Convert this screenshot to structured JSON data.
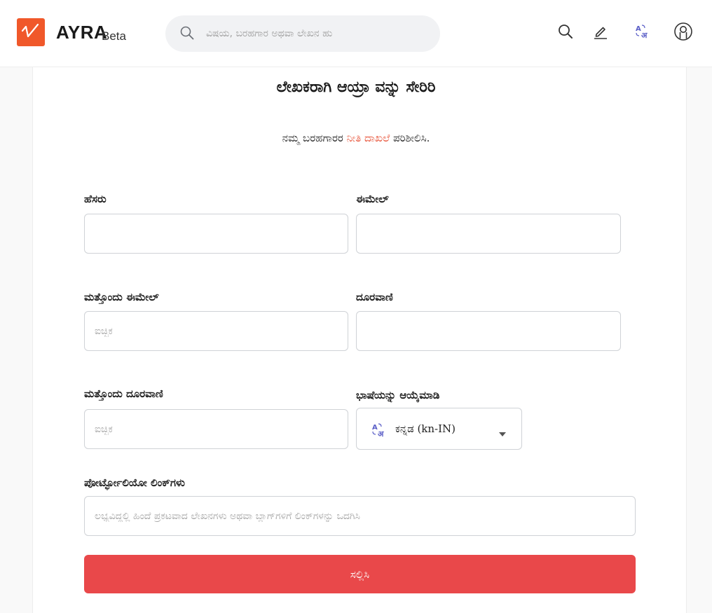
{
  "header": {
    "logo_text": "AYRA",
    "logo_badge": "Beta",
    "search_placeholder": "ವಿಷಯ, ಬರಹಗಾರ ಅಥವಾ ಲೇಖನ ಹು",
    "icons": [
      "search-icon",
      "edit-pencil-icon",
      "language-translate-icon",
      "user-account-icon"
    ]
  },
  "form": {
    "title": "ಲೇಖಕರಾಗಿ ಆಯ್ರಾ ವನ್ನು ಸೇರಿರಿ",
    "subtitle_before": "ನಮ್ಮ ಬರಹಗಾರರ ",
    "subtitle_link": "ನೀತಿ ದಾಖಲೆ",
    "subtitle_after": " ಪರಿಶೀಲಿಸಿ.",
    "name_label": "ಹೆಸರು",
    "email_label": "ಈಮೇಲ್",
    "alt_email_label": "ಮತ್ತೊಂದು ಈಮೇಲ್",
    "alt_email_placeholder": "ಐಚ್ಛಿಕ",
    "phone_label": "ದೂರವಾಣಿ",
    "alt_phone_label": "ಮತ್ತೊಂದು ದೂರವಾಣಿ",
    "alt_phone_placeholder": "ಐಚ್ಛಿಕ",
    "language_label": "ಭಾಷೆಯನ್ನು ಆಯ್ಕೆಮಾಡಿ",
    "language_value": "ಕನ್ನಡ (kn-IN)",
    "portfolio_label": "ಪೋರ್ಟ್ಫೋಲಿಯೋ ಲಿಂಕ್‌ಗಳು",
    "portfolio_placeholder": "ಲಭ್ಯವಿದ್ದಲ್ಲಿ ಹಿಂದೆ ಪ್ರಕಟವಾದ ಲೇಖನಗಳು ಅಥವಾ ಬ್ಲಾಗ್‌ಗಳಿಗೆ ಲಿಂಕ್‌ಗಳನ್ನು ಒದಗಿಸಿ",
    "submit_label": "ಸಲ್ಲಿಸಿ"
  },
  "colors": {
    "brand": "#f0582a",
    "link": "#e8553b",
    "submit": "#e9484a",
    "translate_icon": "#5b5fc7"
  }
}
